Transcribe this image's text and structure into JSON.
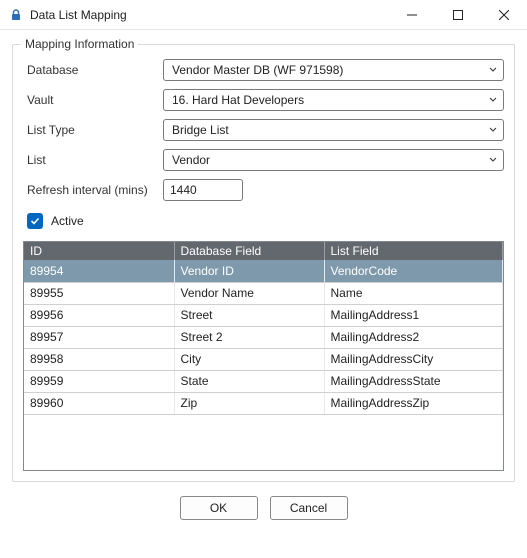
{
  "window": {
    "title": "Data List Mapping"
  },
  "group": {
    "legend": "Mapping Information"
  },
  "labels": {
    "database": "Database",
    "vault": "Vault",
    "listType": "List Type",
    "list": "List",
    "refresh": "Refresh interval (mins)",
    "active": "Active"
  },
  "values": {
    "database": "Vendor Master DB (WF 971598)",
    "vault": "16. Hard Hat Developers",
    "listType": "Bridge List",
    "list": "Vendor",
    "refresh": "1440",
    "activeChecked": true
  },
  "table": {
    "headers": [
      "ID",
      "Database Field",
      "List Field"
    ],
    "rows": [
      {
        "id": "89954",
        "dbField": "Vendor ID",
        "listField": "VendorCode",
        "selected": true
      },
      {
        "id": "89955",
        "dbField": "Vendor Name",
        "listField": "Name"
      },
      {
        "id": "89956",
        "dbField": "Street",
        "listField": "MailingAddress1"
      },
      {
        "id": "89957",
        "dbField": "Street 2",
        "listField": "MailingAddress2"
      },
      {
        "id": "89958",
        "dbField": "City",
        "listField": "MailingAddressCity"
      },
      {
        "id": "89959",
        "dbField": "State",
        "listField": "MailingAddressState"
      },
      {
        "id": "89960",
        "dbField": "Zip",
        "listField": "MailingAddressZip"
      }
    ]
  },
  "buttons": {
    "ok": "OK",
    "cancel": "Cancel"
  }
}
